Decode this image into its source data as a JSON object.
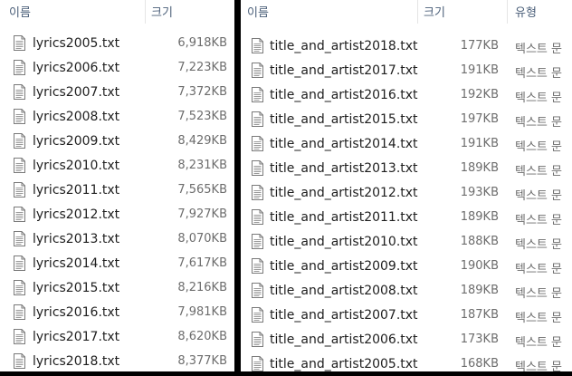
{
  "left_pane": {
    "columns": {
      "name": "이름",
      "size": "크기"
    },
    "files": [
      {
        "name": "lyrics2005.txt",
        "size": "6,918KB"
      },
      {
        "name": "lyrics2006.txt",
        "size": "7,223KB"
      },
      {
        "name": "lyrics2007.txt",
        "size": "7,372KB"
      },
      {
        "name": "lyrics2008.txt",
        "size": "7,523KB"
      },
      {
        "name": "lyrics2009.txt",
        "size": "8,429KB"
      },
      {
        "name": "lyrics2010.txt",
        "size": "8,231KB"
      },
      {
        "name": "lyrics2011.txt",
        "size": "7,565KB"
      },
      {
        "name": "lyrics2012.txt",
        "size": "7,927KB"
      },
      {
        "name": "lyrics2013.txt",
        "size": "8,070KB"
      },
      {
        "name": "lyrics2014.txt",
        "size": "7,617KB"
      },
      {
        "name": "lyrics2015.txt",
        "size": "8,216KB"
      },
      {
        "name": "lyrics2016.txt",
        "size": "7,981KB"
      },
      {
        "name": "lyrics2017.txt",
        "size": "8,620KB"
      },
      {
        "name": "lyrics2018.txt",
        "size": "8,377KB"
      }
    ]
  },
  "right_pane": {
    "columns": {
      "name": "이름",
      "size": "크기",
      "type": "유형"
    },
    "files": [
      {
        "name": "title_and_artist2018.txt",
        "size": "177KB",
        "type": "텍스트 문"
      },
      {
        "name": "title_and_artist2017.txt",
        "size": "191KB",
        "type": "텍스트 문"
      },
      {
        "name": "title_and_artist2016.txt",
        "size": "192KB",
        "type": "텍스트 문"
      },
      {
        "name": "title_and_artist2015.txt",
        "size": "197KB",
        "type": "텍스트 문"
      },
      {
        "name": "title_and_artist2014.txt",
        "size": "191KB",
        "type": "텍스트 문"
      },
      {
        "name": "title_and_artist2013.txt",
        "size": "189KB",
        "type": "텍스트 문"
      },
      {
        "name": "title_and_artist2012.txt",
        "size": "193KB",
        "type": "텍스트 문"
      },
      {
        "name": "title_and_artist2011.txt",
        "size": "189KB",
        "type": "텍스트 문"
      },
      {
        "name": "title_and_artist2010.txt",
        "size": "188KB",
        "type": "텍스트 문"
      },
      {
        "name": "title_and_artist2009.txt",
        "size": "190KB",
        "type": "텍스트 문"
      },
      {
        "name": "title_and_artist2008.txt",
        "size": "189KB",
        "type": "텍스트 문"
      },
      {
        "name": "title_and_artist2007.txt",
        "size": "187KB",
        "type": "텍스트 문"
      },
      {
        "name": "title_and_artist2006.txt",
        "size": "173KB",
        "type": "텍스트 문"
      },
      {
        "name": "title_and_artist2005.txt",
        "size": "168KB",
        "type": "텍스트 문"
      }
    ]
  },
  "file_icon": "text-file-icon"
}
